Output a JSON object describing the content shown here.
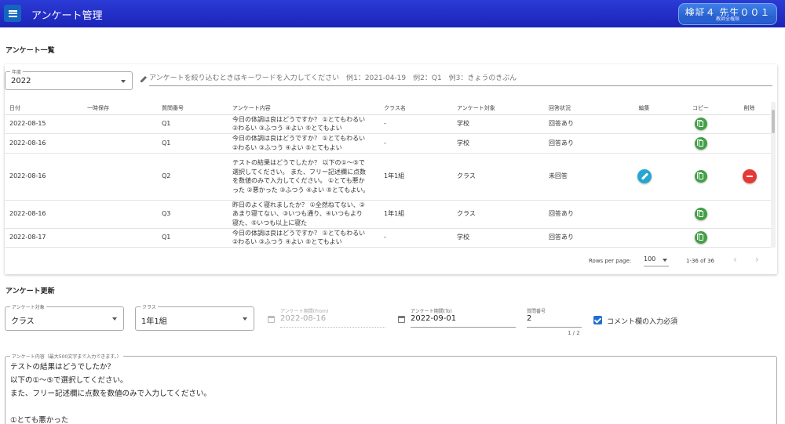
{
  "app": {
    "title": "アンケート管理",
    "user_name": "検証４ 先生００１",
    "user_role": "教師全権限"
  },
  "list_section": {
    "title": "アンケート一覧",
    "year_label": "年度",
    "year_value": "2022",
    "search_placeholder": "アンケートを絞り込むときはキーワードを入力してください　例1：2021-04-19　例2：Q1　例3：きょうのきぶん"
  },
  "table": {
    "headers": [
      "日付",
      "一時保存",
      "質問番号",
      "アンケート内容",
      "クラス名",
      "アンケート対象",
      "回答状況",
      "編集",
      "コピー",
      "削除"
    ],
    "rows": [
      {
        "date": "2022-08-15",
        "temp": "",
        "qno": "Q1",
        "content": [
          "今日の体調は良はどうですか？ ①とてもわるい",
          "②わるい ③ふつう ④よい ⑤とてもよい"
        ],
        "class": "-",
        "target": "学校",
        "status": "回答あり",
        "edit": false,
        "delete": false
      },
      {
        "date": "2022-08-16",
        "temp": "",
        "qno": "Q1",
        "content": [
          "今日の体調は良はどうですか？ ①とてもわるい",
          "②わるい ③ふつう ④よい ⑤とてもよい"
        ],
        "class": "-",
        "target": "学校",
        "status": "回答あり",
        "edit": false,
        "delete": false
      },
      {
        "date": "2022-08-16",
        "temp": "",
        "qno": "Q2",
        "content": [
          "テストの結果はどうでしたか？ 以下の①～⑤で",
          "選択してください。 また、フリー記述欄に点数",
          "を数値のみで入力してください。 ①とても悪か",
          "った ②悪かった ③ふつう ④よい ⑤とてもよい。"
        ],
        "class": "1年1組",
        "target": "クラス",
        "status": "未回答",
        "edit": true,
        "delete": true
      },
      {
        "date": "2022-08-16",
        "temp": "",
        "qno": "Q3",
        "content": [
          "昨日のよく寝れましたか？ ①全然ねてない、②",
          "あまり寝てない、③いつも通り、④いつもより",
          "寝た、⑤いつも以上に寝た"
        ],
        "class": "1年1組",
        "target": "クラス",
        "status": "回答あり",
        "edit": false,
        "delete": false
      },
      {
        "date": "2022-08-17",
        "temp": "",
        "qno": "Q1",
        "content": [
          "今日の体調は良はどうですか？ ①とてもわるい",
          "②わるい ③ふつう ④よい ⑤とてもよい"
        ],
        "class": "-",
        "target": "学校",
        "status": "回答あり",
        "edit": false,
        "delete": false
      }
    ]
  },
  "pager": {
    "rows_per_page_label": "Rows per page:",
    "rows_per_page_value": "100",
    "range": "1-36 of 36",
    "prev": "‹",
    "next": "›"
  },
  "update_section": {
    "title": "アンケート更新",
    "target_label": "アンケート対象",
    "target_value": "クラス",
    "class_label": "クラス",
    "class_value": "1年1組",
    "from_label": "アンケート期間(From)",
    "from_value": "2022-08-16",
    "to_label": "アンケート期間(To)",
    "to_value": "2022-09-01",
    "qno_label": "質問番号",
    "qno_value": "2",
    "qno_counter": "1 / 2",
    "comment_required_label": "コメント欄の入力必須",
    "content_label": "アンケート内容（最大500文字まで入力できます。）",
    "content_lines": [
      "テストの結果はどうでしたか？",
      "以下の①～⑤で選択してください。",
      "また、フリー記述欄に点数を数値のみで入力してください。",
      "",
      "①とても悪かった"
    ]
  }
}
